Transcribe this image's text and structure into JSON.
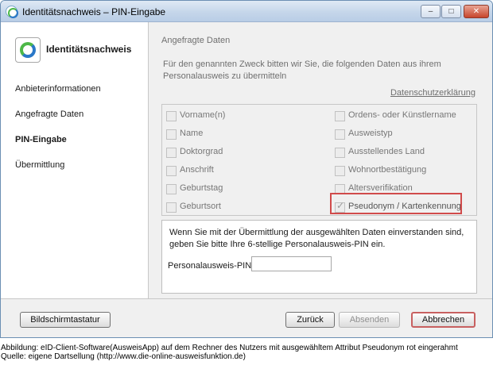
{
  "window": {
    "title": "Identitätsnachweis – PIN-Eingabe",
    "controls": {
      "minimize": "–",
      "maximize": "□",
      "close": "✕"
    }
  },
  "sidebar": {
    "header": "Identitätsnachweis",
    "items": [
      {
        "label": "Anbieterinformationen",
        "active": false
      },
      {
        "label": "Angefragte Daten",
        "active": false
      },
      {
        "label": "PIN-Eingabe",
        "active": true
      },
      {
        "label": "Übermittlung",
        "active": false
      }
    ]
  },
  "main": {
    "section_title": "Angefragte Daten",
    "intro": "Für den genannten Zweck bitten wir Sie, die folgenden Daten aus ihrem Personalausweis zu übermitteln",
    "privacy_link": "Datenschutzerklärung",
    "attributes_left": [
      {
        "label": "Vorname(n)",
        "checked": false
      },
      {
        "label": "Name",
        "checked": false
      },
      {
        "label": "Doktorgrad",
        "checked": false
      },
      {
        "label": "Anschrift",
        "checked": false
      },
      {
        "label": "Geburtstag",
        "checked": false
      },
      {
        "label": "Geburtsort",
        "checked": false
      }
    ],
    "attributes_right": [
      {
        "label": "Ordens- oder Künstlername",
        "checked": false
      },
      {
        "label": "Ausweistyp",
        "checked": false
      },
      {
        "label": "Ausstellendes Land",
        "checked": false
      },
      {
        "label": "Wohnortbestätigung",
        "checked": false
      },
      {
        "label": "Altersverifikation",
        "checked": false
      },
      {
        "label": "Pseudonym / Kartenkennung",
        "checked": true
      }
    ],
    "pin_instructions": "Wenn Sie mit der Übermittlung der ausgewählten Daten einverstanden sind, geben Sie bitte Ihre 6-stellige Personalausweis-PIN ein.",
    "pin_label": "Personalausweis-PIN",
    "pin_value": ""
  },
  "footer": {
    "keyboard_button": "Bildschirmtastatur",
    "back_button": "Zurück",
    "send_button": "Absenden",
    "cancel_button": "Abbrechen"
  },
  "caption": {
    "line1": "Abbildung: eID-Client-Software(AusweisApp) auf dem Rechner des Nutzers mit ausgewähltem Attribut Pseudonym rot eingerahmt",
    "line2": "Quelle: eigene Dartsellung (http://www.die-online-ausweisfunktion.de)"
  },
  "colors": {
    "highlight": "#d14b4b",
    "logo_green": "#4db848",
    "logo_blue": "#2a78c8",
    "titlebar": "#c5d6ea"
  },
  "icons": {
    "app": "ausweisapp-logo-icon",
    "minimize": "minimize-icon",
    "maximize": "maximize-icon",
    "close": "close-icon"
  }
}
